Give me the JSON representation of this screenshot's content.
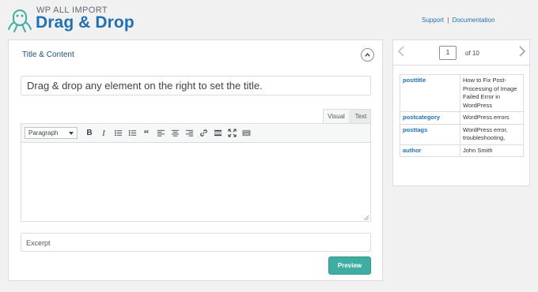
{
  "brand": {
    "small": "WP ALL IMPORT",
    "big": "Drag & Drop",
    "logo_icon": "octopus-logo-icon"
  },
  "help": {
    "support": "Support",
    "separator": "|",
    "documentation": "Documentation"
  },
  "main": {
    "section_title": "Title & Content",
    "collapse_icon": "chevron-up-icon",
    "title_placeholder": "Drag & drop any element on the right to set the title.",
    "tabs": [
      {
        "label": "Visual",
        "active": true
      },
      {
        "label": "Text",
        "active": false
      }
    ],
    "toolbar": {
      "format_value": "Paragraph",
      "buttons": [
        "bold",
        "italic",
        "bulleted-list",
        "numbered-list",
        "blockquote",
        "align-left",
        "align-center",
        "align-right",
        "link",
        "read-more",
        "fullscreen",
        "toolbar-toggle"
      ]
    },
    "excerpt_placeholder": "Excerpt",
    "preview_label": "Preview"
  },
  "record": {
    "page": "1",
    "of_label": "of 10",
    "rows": [
      {
        "key": "posttitle",
        "value": "How to Fix Post-Processing of Image Failed Error in WordPress"
      },
      {
        "key": "postcategory",
        "value": "WordPress errors"
      },
      {
        "key": "posttags",
        "value": "WordPress error, troubleshooting,"
      },
      {
        "key": "author",
        "value": "John Smith"
      }
    ]
  },
  "colors": {
    "accent": "#2271b1",
    "preview_button": "#40ada3"
  }
}
